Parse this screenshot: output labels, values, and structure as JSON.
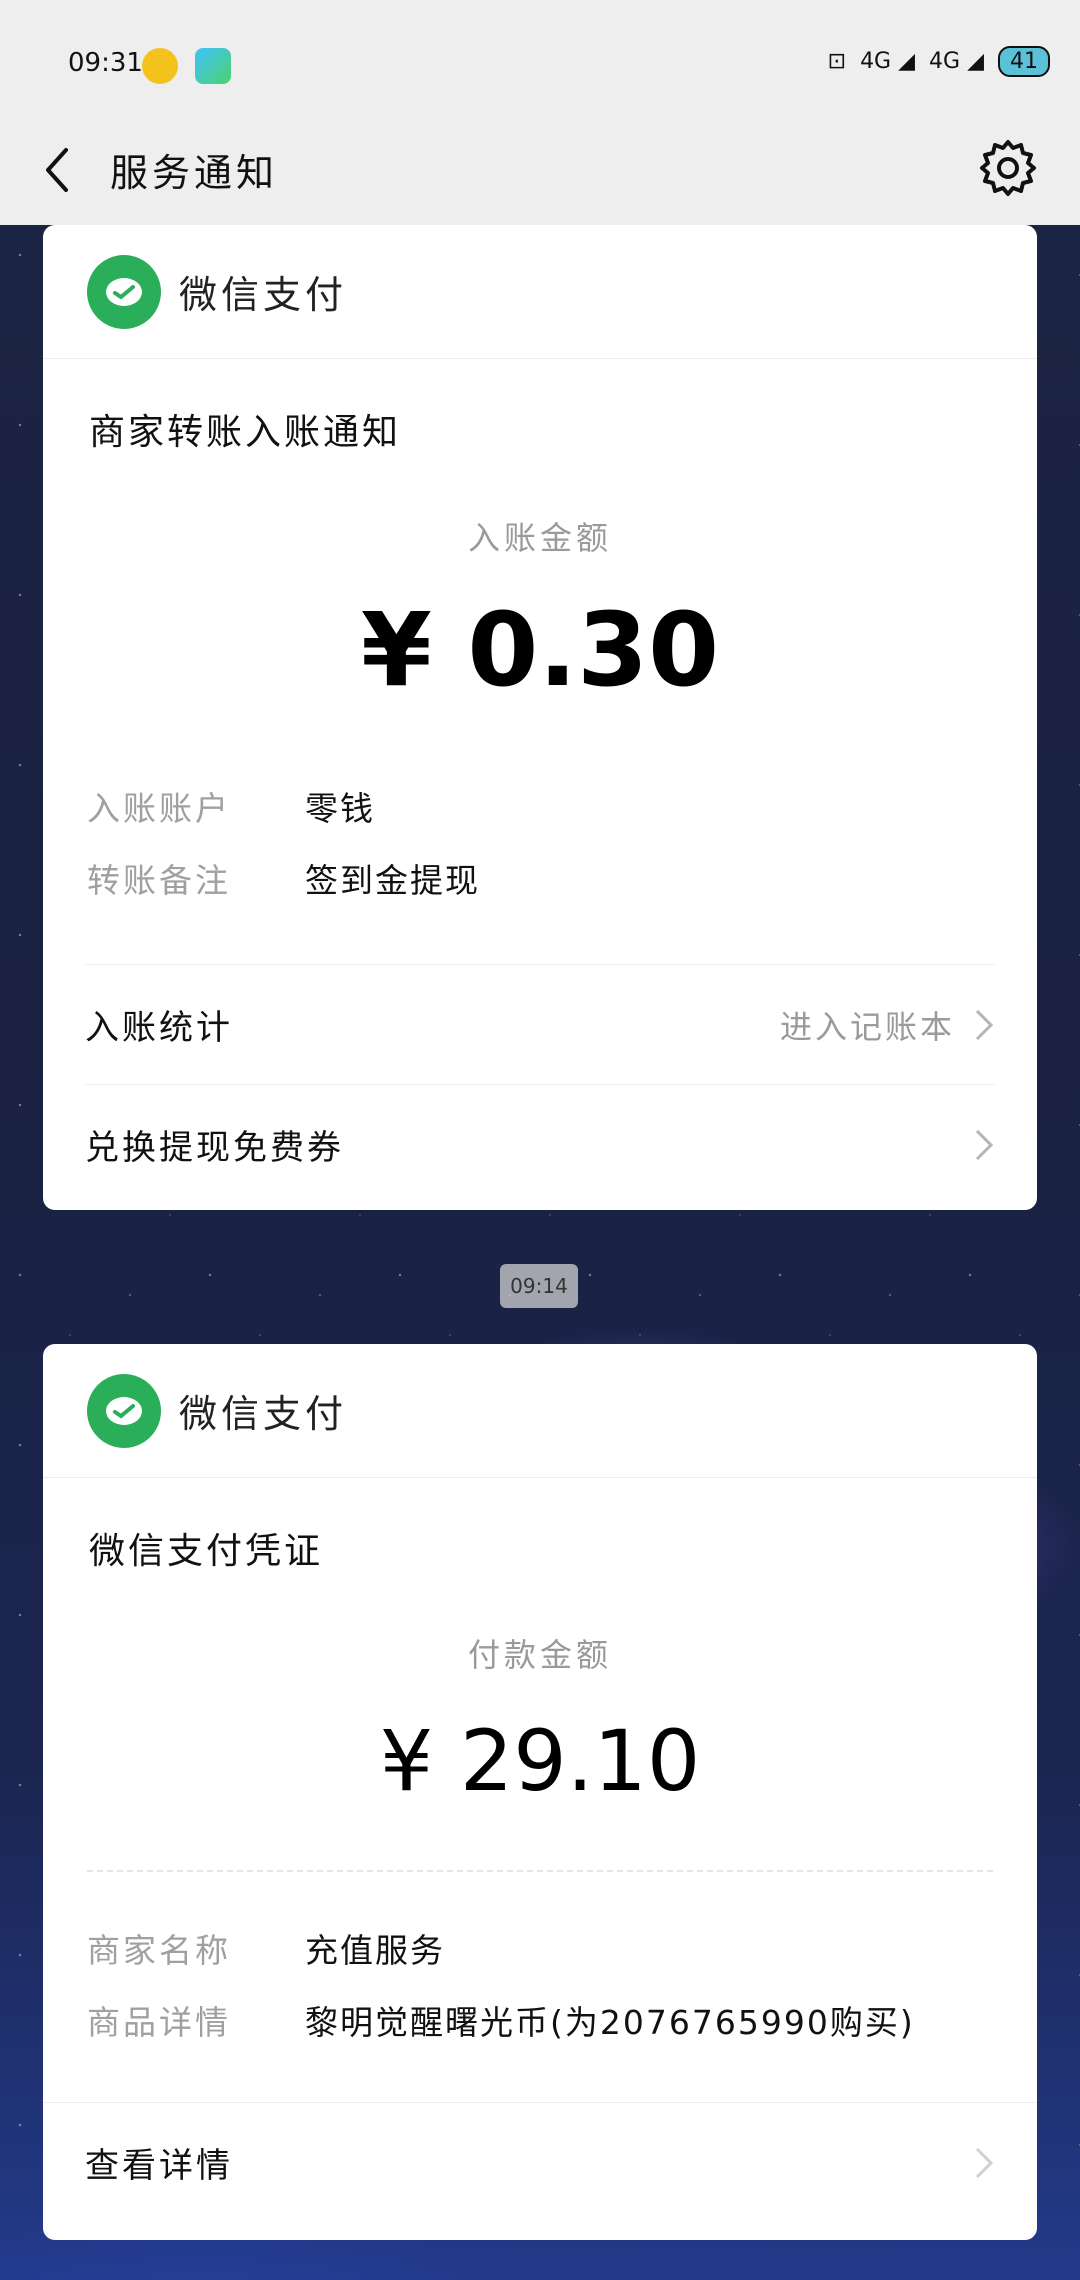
{
  "status_bar": {
    "time": "09:31",
    "icons": [
      "music-app-icon",
      "video-app-icon",
      "nfc-icon",
      "signal-4g-icon",
      "signal-4g-icon"
    ],
    "net1": "4G",
    "net2": "4G",
    "battery": "41"
  },
  "header": {
    "title": "服务通知",
    "back_icon": "chevron-left-icon",
    "settings_icon": "gear-icon"
  },
  "cards": [
    {
      "brand": "微信支付",
      "title": "商家转账入账通知",
      "amount_label": "入账金额",
      "amount": "¥ 0.30",
      "rows": [
        {
          "key": "入账账户",
          "value": "零钱"
        },
        {
          "key": "转账备注",
          "value": "签到金提现"
        }
      ],
      "links": [
        {
          "label": "入账统计",
          "right": "进入记账本"
        },
        {
          "label": "兑换提现免费券",
          "right": ""
        }
      ]
    },
    {
      "brand": "微信支付",
      "title": "微信支付凭证",
      "amount_label": "付款金额",
      "amount": "¥ 29.10",
      "rows": [
        {
          "key": "商家名称",
          "value": "充值服务"
        },
        {
          "key": "商品详情",
          "value": "黎明觉醒曙光币(为2076765990购买)"
        }
      ],
      "links": [
        {
          "label": "查看详情",
          "right": ""
        }
      ]
    }
  ],
  "timestamp_chip": "09:14",
  "colors": {
    "wechat_green": "#2aae5a",
    "background_top": "#eeeeee",
    "card": "#ffffff"
  }
}
